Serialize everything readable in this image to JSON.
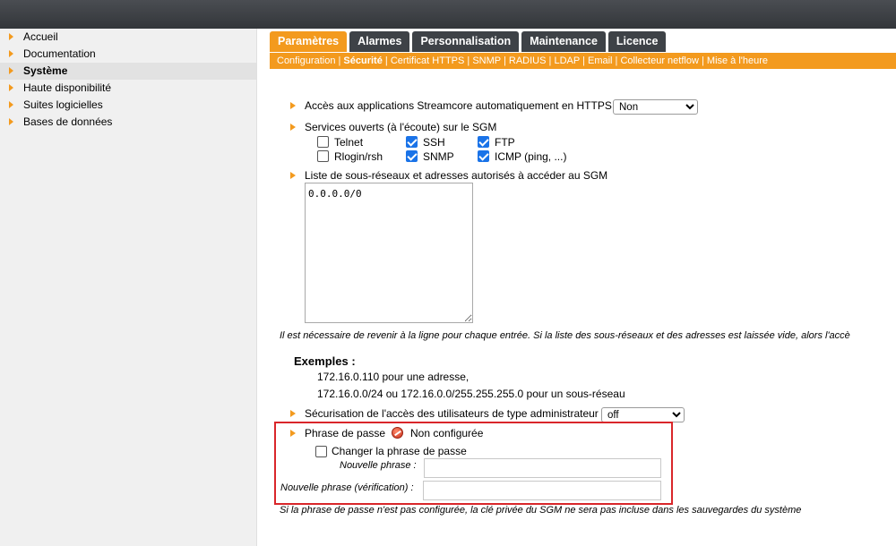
{
  "sidebar": {
    "items": [
      {
        "label": "Accueil"
      },
      {
        "label": "Documentation"
      },
      {
        "label": "Système"
      },
      {
        "label": "Haute disponibilité"
      },
      {
        "label": "Suites logicielles"
      },
      {
        "label": "Bases de données"
      }
    ]
  },
  "tabs": [
    "Paramètres",
    "Alarmes",
    "Personnalisation",
    "Maintenance",
    "Licence"
  ],
  "subnav": [
    "Configuration",
    "Sécurité",
    "Certificat HTTPS",
    "SNMP",
    "RADIUS",
    "LDAP",
    "Email",
    "Collecteur netflow",
    "Mise à l'heure"
  ],
  "https": {
    "label": "Accès aux applications Streamcore automatiquement en HTTPS :",
    "value": "Non"
  },
  "services": {
    "label": "Services ouverts (à l'écoute) sur le SGM",
    "items": [
      {
        "label": "Telnet",
        "checked": false
      },
      {
        "label": "SSH",
        "checked": true
      },
      {
        "label": "FTP",
        "checked": true
      },
      {
        "label": "Rlogin/rsh",
        "checked": false
      },
      {
        "label": "SNMP",
        "checked": true
      },
      {
        "label": "ICMP (ping, ...)",
        "checked": true
      }
    ]
  },
  "subnets": {
    "label": "Liste de sous-réseaux et adresses autorisés à accéder au SGM",
    "value": "0.0.0.0/0",
    "note": "Il est nécessaire de revenir à la ligne pour chaque entrée. Si la liste des sous-réseaux et des adresses est laissée vide, alors l'accè"
  },
  "examples": {
    "title": "Exemples :",
    "line1": "172.16.0.110 pour une adresse,",
    "line2": "172.16.0.0/24 ou 172.16.0.0/255.255.255.0 pour un sous-réseau"
  },
  "admin": {
    "label": "Sécurisation de l'accès des utilisateurs de type administrateur :",
    "value": "off"
  },
  "passphrase": {
    "label": "Phrase de passe",
    "status": "Non configurée",
    "status_icon": "error-icon",
    "change_label": "Changer la phrase de passe",
    "new_label": "Nouvelle phrase :",
    "verify_label": "Nouvelle phrase (vérification) :",
    "note": "Si la phrase de passe n'est pas configurée, la clé privée du SGM ne sera pas incluse dans les sauvegardes du système"
  },
  "colors": {
    "accent": "#f39a1e",
    "tab_dark": "#3e4247",
    "highlight": "#d9262a"
  }
}
